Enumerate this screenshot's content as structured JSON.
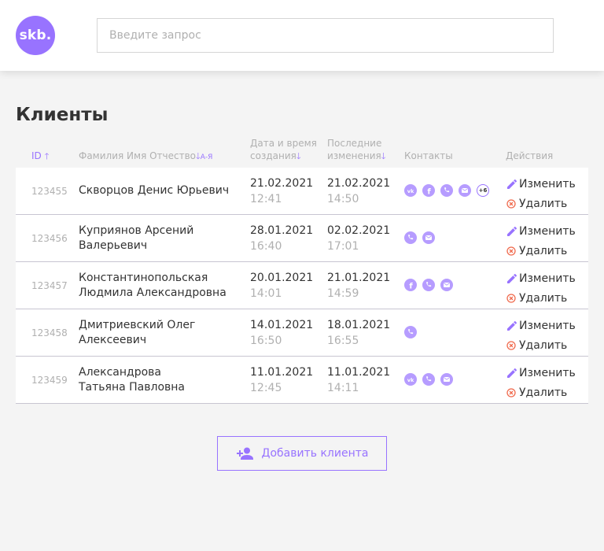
{
  "header": {
    "logo_text": "skb.",
    "search_placeholder": "Введите запрос"
  },
  "page": {
    "title": "Клиенты"
  },
  "columns": {
    "id": "ID",
    "name": "Фамилия Имя Отчество",
    "name_sort_hint": "А-Я",
    "created_line1": "Дата и время",
    "created_line2": "создания",
    "updated_line1": "Последние",
    "updated_line2": "изменения",
    "contacts": "Контакты",
    "actions": "Действия"
  },
  "clients": [
    {
      "id": "123455",
      "name_line1": "Скворцов Денис Юрьевич",
      "name_line2": "",
      "created_date": "21.02.2021",
      "created_time": "12:41",
      "updated_date": "21.02.2021",
      "updated_time": "14:50",
      "contacts": [
        "vk-icon",
        "facebook-icon",
        "phone-icon",
        "email-icon"
      ],
      "more_contacts": "+6"
    },
    {
      "id": "123456",
      "name_line1": "Куприянов Арсений",
      "name_line2": "Валерьевич",
      "created_date": "28.01.2021",
      "created_time": "16:40",
      "updated_date": "02.02.2021",
      "updated_time": "17:01",
      "contacts": [
        "phone-icon",
        "email-icon"
      ],
      "more_contacts": ""
    },
    {
      "id": "123457",
      "name_line1": "Константинопольская",
      "name_line2": "Людмила Александровна",
      "created_date": "20.01.2021",
      "created_time": "14:01",
      "updated_date": "21.01.2021",
      "updated_time": "14:59",
      "contacts": [
        "facebook-icon",
        "phone-icon",
        "email-icon"
      ],
      "more_contacts": ""
    },
    {
      "id": "123458",
      "name_line1": "Дмитриевский Олег",
      "name_line2": "Алексеевич",
      "created_date": "14.01.2021",
      "created_time": "16:50",
      "updated_date": "18.01.2021",
      "updated_time": "16:55",
      "contacts": [
        "phone-icon"
      ],
      "more_contacts": ""
    },
    {
      "id": "123459",
      "name_line1": "Александрова",
      "name_line2": "Татьяна Павловна",
      "created_date": "11.01.2021",
      "created_time": "12:45",
      "updated_date": "11.01.2021",
      "updated_time": "14:11",
      "contacts": [
        "vk-icon",
        "phone-icon",
        "email-icon"
      ],
      "more_contacts": ""
    }
  ],
  "actions": {
    "edit_label": "Изменить",
    "delete_label": "Удалить"
  },
  "add_button": {
    "label": "Добавить клиента"
  },
  "colors": {
    "accent": "#9873ff",
    "delete": "#f06a4d",
    "background": "#f4f4f4"
  }
}
